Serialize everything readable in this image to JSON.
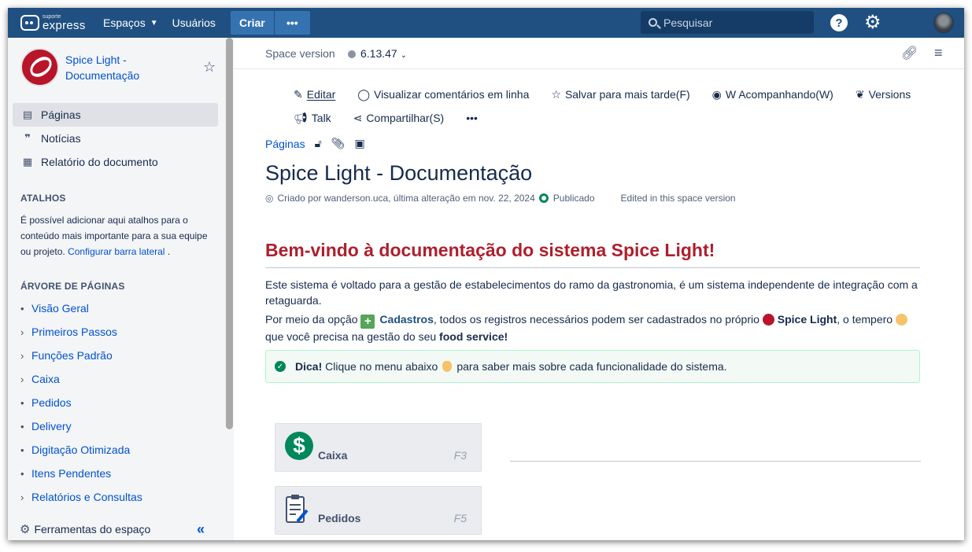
{
  "topnav": {
    "logo_small": "suporte",
    "logo_big": "express",
    "espacos": "Espaços",
    "usuarios": "Usuários",
    "criar": "Criar",
    "more": "•••",
    "search_placeholder": "Pesquisar"
  },
  "sidebar": {
    "space_name": "Spice Light - Documentação",
    "nav": [
      {
        "label": "Páginas",
        "icon": "page-icon"
      },
      {
        "label": "Notícias",
        "icon": "quote-icon"
      },
      {
        "label": "Relatório do documento",
        "icon": "report-icon"
      }
    ],
    "atalhos_title": "ATALHOS",
    "atalhos_text": "É possível adicionar aqui atalhos para o conteúdo mais importante para a sua equipe ou projeto.",
    "atalhos_link": "Configurar barra lateral",
    "tree_title": "ÁRVORE DE PÁGINAS",
    "tree": [
      {
        "label": "Visão Geral",
        "bullet": "•"
      },
      {
        "label": "Primeiros Passos",
        "bullet": "›"
      },
      {
        "label": "Funções Padrão",
        "bullet": "›"
      },
      {
        "label": "Caixa",
        "bullet": "›"
      },
      {
        "label": "Pedidos",
        "bullet": "•"
      },
      {
        "label": "Delivery",
        "bullet": "•"
      },
      {
        "label": "Digitação Otimizada",
        "bullet": "•"
      },
      {
        "label": "Itens Pendentes",
        "bullet": "•"
      },
      {
        "label": "Relatórios e Consultas",
        "bullet": "›"
      }
    ],
    "footer_label": "Ferramentas do espaço",
    "collapse": "«"
  },
  "main": {
    "version_label": "Space version",
    "version_value": "6.13.47",
    "toolbar": {
      "editar": "Editar",
      "comentarios": "Visualizar comentários em linha",
      "salvar": "Salvar para mais tarde(F)",
      "acompanhando": "W Acompanhando(W)",
      "versions": "Versions",
      "talk": "Talk",
      "compartilhar": "Compartilhar(S)",
      "more": "•••"
    },
    "breadcrumb": "Páginas",
    "title": "Spice Light - Documentação",
    "meta_created": "Criado por wanderson.uca, última alteração em nov. 22, 2024",
    "meta_status": "Publicado",
    "meta_edited": "Edited in this space version",
    "welcome": "Bem-vindo à documentação do sistema Spice Light!",
    "para1": "Este sistema é voltado para a gestão de estabelecimentos do ramo da gastronomia, é um sistema independente de integração com a retaguarda.",
    "para2_a": "Por meio da opção",
    "para2_cadastros": "Cadastros",
    "para2_b": ", todos os registros necessários podem ser cadastrados no próprio",
    "para2_spice": "Spice Light",
    "para2_c": ", o tempero",
    "para2_d": "que você precisa na gestão do seu",
    "para2_food": "food service!",
    "tip_bold": "Dica!",
    "tip_a": "Clique no menu abaixo",
    "tip_b": "para saber mais sobre cada funcionalidade do sistema.",
    "cards": [
      {
        "name": "Caixa",
        "key": "F3"
      },
      {
        "name": "Pedidos",
        "key": "F5"
      }
    ]
  },
  "colors": {
    "nav_bg": "#205081",
    "accent": "#0052cc",
    "welcome_red": "#ae1f2d",
    "success_green": "#00875a"
  }
}
